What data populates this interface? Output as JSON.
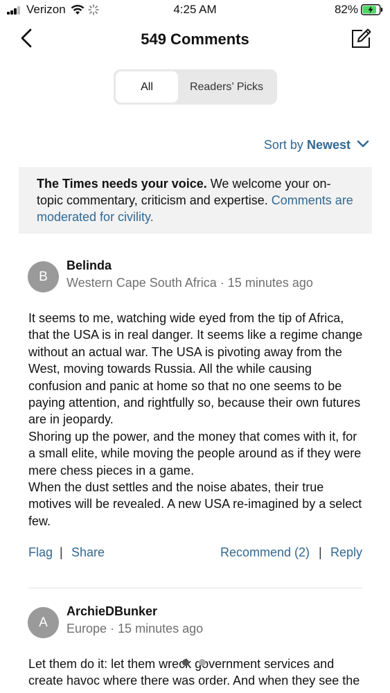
{
  "status_bar": {
    "carrier": "Verizon",
    "time": "4:25 AM",
    "battery_percent": "82%",
    "icons": [
      "signal-icon",
      "wifi-icon",
      "activity-spinner-icon",
      "battery-charging-icon"
    ]
  },
  "header": {
    "title": "549 Comments",
    "back_icon": "chevron-left-icon",
    "compose_icon": "compose-icon"
  },
  "tabs": [
    {
      "label": "All",
      "selected": true
    },
    {
      "label": "Readers’ Picks",
      "selected": false
    }
  ],
  "sort": {
    "prefix": "Sort by",
    "value": "Newest",
    "icon": "chevron-down-icon",
    "color": "#326891"
  },
  "notice": {
    "bold": "The Times needs your voice.",
    "text": " We welcome your on-topic commentary, criticism and expertise. ",
    "link": "Comments are moderated for civility."
  },
  "comments": [
    {
      "initial": "B",
      "author": "Belinda",
      "location": "Western Cape South Africa",
      "time": "15 minutes ago",
      "paragraphs": [
        "It seems to me, watching wide eyed from the tip of Africa, that the USA is in real danger. It seems like a regime change without an actual war. The USA is pivoting away from the West, moving towards Russia. All the while causing confusion and panic at home so that no one seems to be paying attention, and rightfully so, because their own futures are in jeopardy.",
        "Shoring up the power, and the money that comes with it, for a small elite, while moving the people around as if they were mere chess pieces in a game.",
        "When the dust settles and the noise abates, their true motives will be revealed. A new USA re-imagined by a select few."
      ],
      "actions": {
        "flag": "Flag",
        "share": "Share",
        "recommend": "Recommend (2)",
        "reply": "Reply"
      }
    },
    {
      "initial": "A",
      "author": "ArchieDBunker",
      "location": "Europe",
      "time": "15 minutes ago",
      "paragraphs": [
        "Let them do it: let them wreck government services and create havoc where there was order. And when they see the"
      ]
    }
  ],
  "colors": {
    "link": "#326891",
    "avatar": "#9a9a9a",
    "notice_bg": "#f2f2f2",
    "meta": "#707070"
  }
}
